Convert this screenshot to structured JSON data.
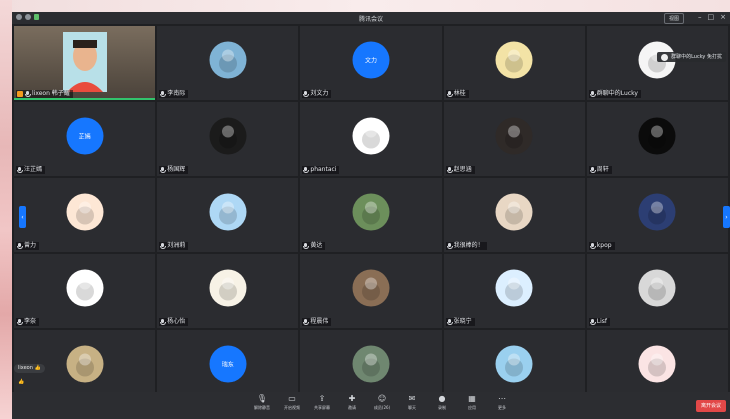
{
  "window": {
    "title": "腾讯会议",
    "view_label": "视图",
    "controls": [
      "–",
      "□",
      "×"
    ]
  },
  "participants": [
    {
      "name": "lixeon 韩子耀",
      "type": "video",
      "host": true,
      "speaking": true
    },
    {
      "name": "李南际",
      "type": "image",
      "color": "#7fb3d5"
    },
    {
      "name": "刘文力",
      "type": "text",
      "avatar_text": "文力"
    },
    {
      "name": "林桂",
      "type": "image",
      "color": "#f3e3a6"
    },
    {
      "name": "群聊中的Lucky",
      "type": "image",
      "color": "#f5f5f5"
    },
    {
      "name": "汪芷嫣",
      "type": "text",
      "avatar_text": "芷嫣"
    },
    {
      "name": "杨国辉",
      "type": "image",
      "color": "#1b1b1b"
    },
    {
      "name": "phantaci",
      "type": "image",
      "color": "#ffffff"
    },
    {
      "name": "赵思涵",
      "type": "image",
      "color": "#2f2a28"
    },
    {
      "name": "周轩",
      "type": "image",
      "color": "#0b0b0b"
    },
    {
      "name": "曾力",
      "type": "image",
      "color": "#fde7d5"
    },
    {
      "name": "刘洲莉",
      "type": "image",
      "color": "#aed8f5"
    },
    {
      "name": "黄达",
      "type": "image",
      "color": "#6c8f5b"
    },
    {
      "name": "我很棒的！",
      "type": "image",
      "color": "#e8d7c4"
    },
    {
      "name": "kpop",
      "type": "image",
      "color": "#2c3e73"
    },
    {
      "name": "李奈",
      "type": "image",
      "color": "#ffffff"
    },
    {
      "name": "杨心怡",
      "type": "image",
      "color": "#f7f2e6"
    },
    {
      "name": "程晨伟",
      "type": "image",
      "color": "#8a6e55"
    },
    {
      "name": "张晓宁",
      "type": "image",
      "color": "#dcefff"
    },
    {
      "name": "Lisf",
      "type": "image",
      "color": "#d8d8d8"
    },
    {
      "name": "",
      "type": "image",
      "color": "#c7b184"
    },
    {
      "name": "",
      "type": "text",
      "avatar_text": "瑞东"
    },
    {
      "name": "",
      "type": "image",
      "color": "#6f8770"
    },
    {
      "name": "",
      "type": "image",
      "color": "#9ad0ef"
    },
    {
      "name": "",
      "type": "image",
      "color": "#fbe4e4"
    }
  ],
  "hover_card": {
    "text": "群聊中的Lucky 免打扰"
  },
  "chips": {
    "first": "lixeon 👍",
    "second": "👍"
  },
  "toolbar": {
    "items": [
      {
        "label": "解除静音",
        "icon": "mic-icon"
      },
      {
        "label": "开启视频",
        "icon": "camera-icon"
      },
      {
        "label": "共享屏幕",
        "icon": "share-icon"
      },
      {
        "label": "邀请",
        "icon": "invite-icon"
      },
      {
        "label": "成员(26)",
        "icon": "members-icon"
      },
      {
        "label": "聊天",
        "icon": "chat-icon"
      },
      {
        "label": "录制",
        "icon": "record-icon"
      },
      {
        "label": "应用",
        "icon": "apps-icon"
      },
      {
        "label": "更多",
        "icon": "more-icon"
      }
    ],
    "end_label": "离开会议"
  },
  "colors": {
    "accent": "#1677ff",
    "speaking": "#32c36c",
    "host": "#f39a1e",
    "end": "#e24848"
  }
}
